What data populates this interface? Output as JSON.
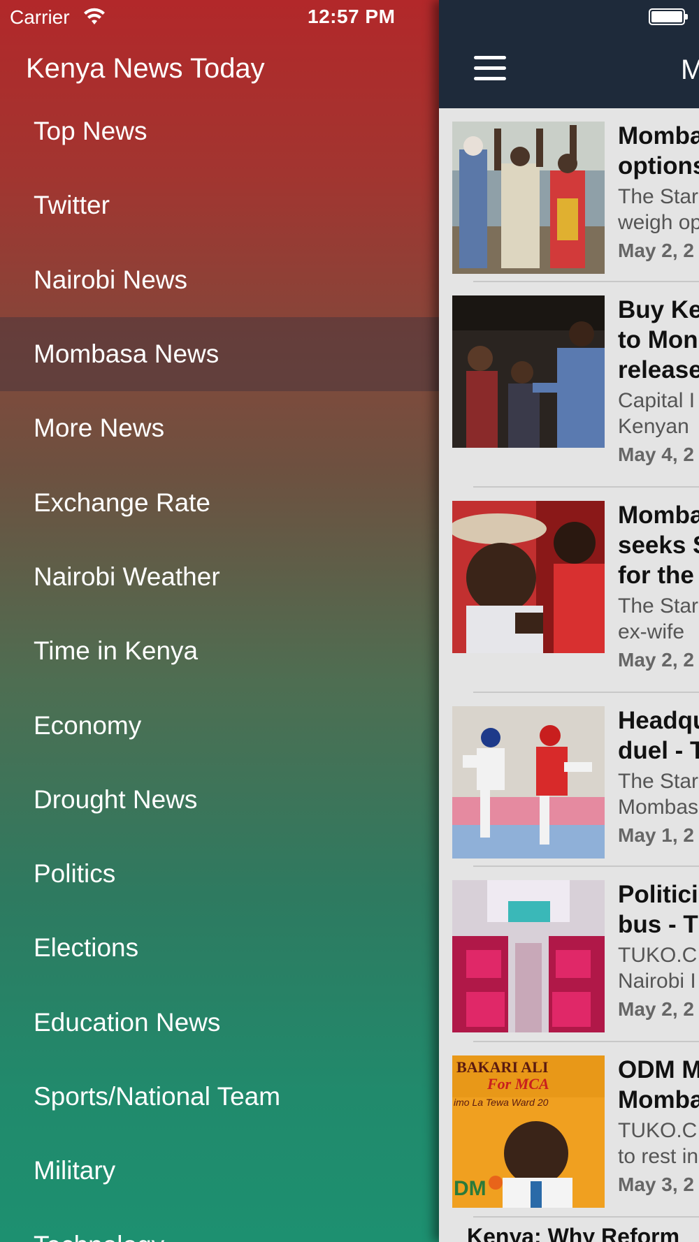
{
  "status_bar": {
    "carrier": "Carrier",
    "time": "12:57 PM"
  },
  "drawer": {
    "title": "Kenya News Today",
    "items": [
      {
        "label": "Top News"
      },
      {
        "label": "Twitter"
      },
      {
        "label": "Nairobi News"
      },
      {
        "label": "Mombasa News",
        "active": true
      },
      {
        "label": "More News"
      },
      {
        "label": "Exchange Rate"
      },
      {
        "label": "Nairobi Weather"
      },
      {
        "label": "Time in Kenya"
      },
      {
        "label": "Economy"
      },
      {
        "label": "Drought News"
      },
      {
        "label": "Politics"
      },
      {
        "label": "Elections"
      },
      {
        "label": "Education News"
      },
      {
        "label": "Sports/National Team"
      },
      {
        "label": "Military"
      },
      {
        "label": "Technology"
      }
    ]
  },
  "navbar": {
    "title": "M",
    "menu_icon": "hamburger-icon"
  },
  "articles": [
    {
      "title": "Momba\noptions",
      "summary": "The Star\nweigh op",
      "date": "May 2, 2"
    },
    {
      "title": "Buy Ke\nto Mon\nrelease",
      "summary": "Capital I\nKenyan",
      "date": "May 4, 2"
    },
    {
      "title": "Momba\nseeks S\nfor the",
      "summary": "The Star\nex-wife",
      "date": "May 2, 2"
    },
    {
      "title": "Headqu\nduel - T",
      "summary": "The Star\nMombas",
      "date": "May 1, 2"
    },
    {
      "title": "Politici\nbus - T",
      "summary": "TUKO.C\nNairobi I",
      "date": "May 2, 2"
    },
    {
      "title": "ODM M\nMomba",
      "summary": "TUKO.C\nto rest in",
      "date": "May 3, 2"
    }
  ],
  "next_article_title": "Kenya: Why Reform",
  "thumbnail_texts": {
    "poster_name": "BAKARI ALI",
    "poster_for": "For MCA",
    "poster_ward": "imo La Tewa Ward 20",
    "poster_party": "DM"
  }
}
